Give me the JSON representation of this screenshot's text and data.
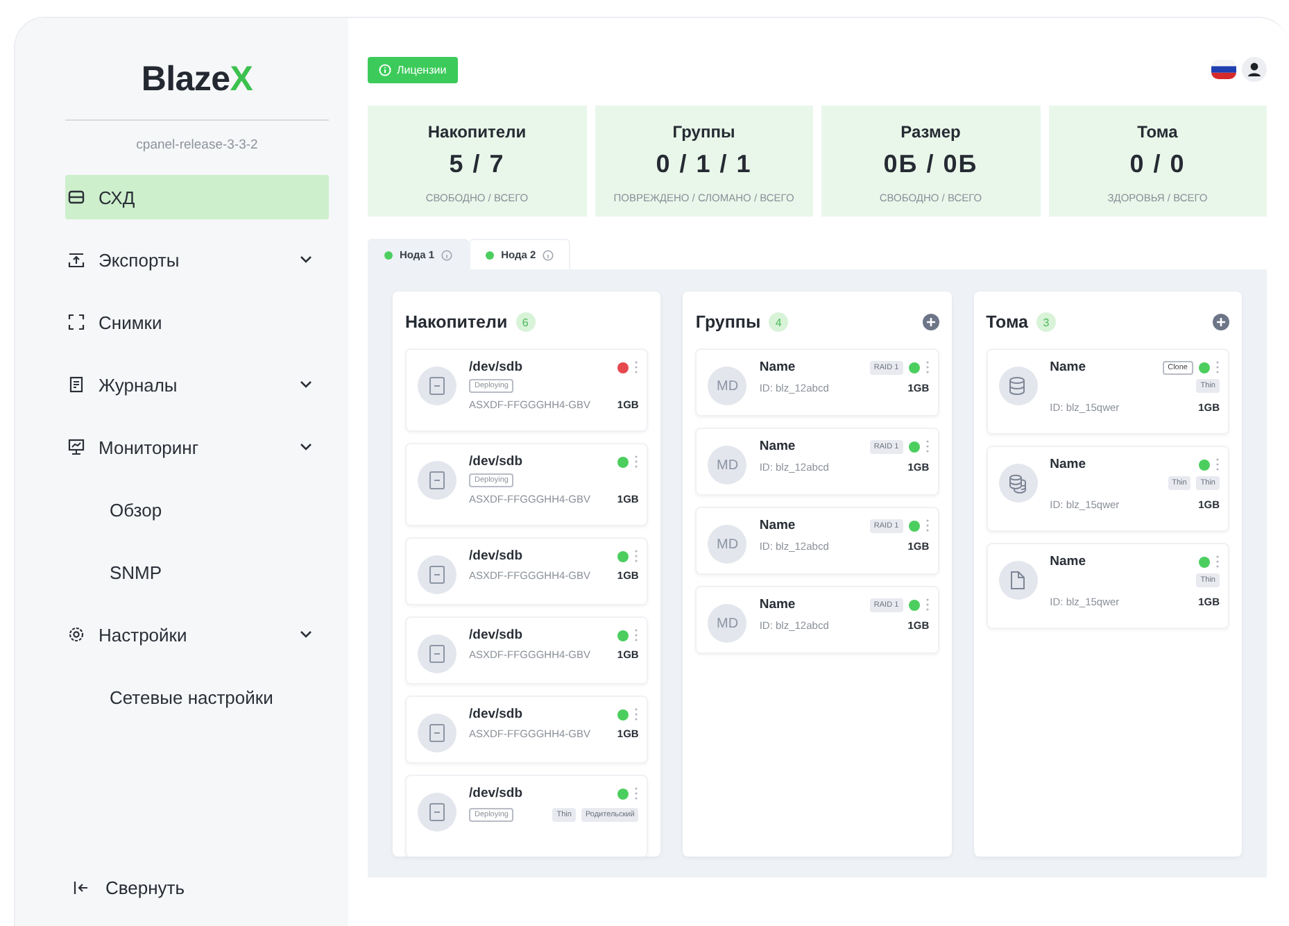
{
  "sidebar": {
    "logo": {
      "text": "Blaze",
      "accent": "X"
    },
    "version": "cpanel-release-3-3-2",
    "items": [
      {
        "label": "СХД",
        "selected": true,
        "expandable": false
      },
      {
        "label": "Экспорты",
        "selected": false,
        "expandable": true
      },
      {
        "label": "Снимки",
        "selected": false,
        "expandable": false
      },
      {
        "label": "Журналы",
        "selected": false,
        "expandable": true
      },
      {
        "label": "Мониторинг",
        "selected": false,
        "expandable": true,
        "children": [
          {
            "label": "Обзор",
            "selected": false
          },
          {
            "label": "SNMP",
            "selected": false
          }
        ]
      },
      {
        "label": "Настройки",
        "selected": false,
        "expandable": true,
        "children": [
          {
            "label": "Сетевые настройки",
            "selected": false
          }
        ]
      }
    ],
    "collapse": "Свернуть"
  },
  "header": {
    "license_button": "Лицензии"
  },
  "stats": [
    {
      "title": "Накопители",
      "value": "5 / 7",
      "caption": "СВОБОДНО / ВСЕГО"
    },
    {
      "title": "Группы",
      "value": "0 / 1 / 1",
      "caption": "ПОВРЕЖДЕНО / СЛОМАНО / ВСЕГО"
    },
    {
      "title": "Размер",
      "value": "0Б / 0Б",
      "caption": "СВОБОДНО / ВСЕГО"
    },
    {
      "title": "Тома",
      "value": "0 / 0",
      "caption": "ЗДОРОВЬЯ / ВСЕГО"
    }
  ],
  "tabs": [
    {
      "label": "Нода 1",
      "selected": true,
      "color": "#4cce5f"
    },
    {
      "label": "Нода 2",
      "selected": false,
      "color": "#4cce5f"
    }
  ],
  "columns": [
    {
      "kind": "drives",
      "title": "Накопители",
      "count": "6",
      "add_button": false,
      "items": [
        {
          "name": "/dev/sdb",
          "color": "#e5484d",
          "state": "Deploying",
          "serial": "ASXDF-FFGGGHH4-GBV",
          "size": "1GB"
        },
        {
          "name": "/dev/sdb",
          "color": "#4cce5f",
          "state": "Deploying",
          "serial": "ASXDF-FFGGGHH4-GBV",
          "size": "1GB"
        },
        {
          "name": "/dev/sdb",
          "color": "#4cce5f",
          "serial": "ASXDF-FFGGGHH4-GBV",
          "size": "1GB"
        },
        {
          "name": "/dev/sdb",
          "color": "#4cce5f",
          "serial": "ASXDF-FFGGGHH4-GBV",
          "size": "1GB"
        },
        {
          "name": "/dev/sdb",
          "color": "#4cce5f",
          "serial": "ASXDF-FFGGGHH4-GBV",
          "size": "1GB"
        },
        {
          "name": "/dev/sdb",
          "color": "#4cce5f",
          "state": "Deploying",
          "tags": [
            "Thin",
            "Родительский"
          ]
        }
      ]
    },
    {
      "kind": "groups",
      "title": "Группы",
      "count": "4",
      "add_button": true,
      "items": [
        {
          "avatar": "MD",
          "name": "Name",
          "raid": "RAID 1",
          "color": "#4cce5f",
          "id": "ID: blz_12abcd",
          "size": "1GB"
        },
        {
          "avatar": "MD",
          "name": "Name",
          "raid": "RAID 1",
          "color": "#4cce5f",
          "id": "ID: blz_12abcd",
          "size": "1GB"
        },
        {
          "avatar": "MD",
          "name": "Name",
          "raid": "RAID 1",
          "color": "#4cce5f",
          "id": "ID: blz_12abcd",
          "size": "1GB"
        },
        {
          "avatar": "MD",
          "name": "Name",
          "raid": "RAID 1",
          "color": "#4cce5f",
          "id": "ID: blz_12abcd",
          "size": "1GB"
        }
      ]
    },
    {
      "kind": "volumes",
      "title": "Тома",
      "count": "3",
      "add_button": true,
      "items": [
        {
          "kind": "database",
          "name": "Name",
          "clone": "Clone",
          "color": "#4cce5f",
          "tags": [
            "Thin"
          ],
          "id": "ID: blz_15qwer",
          "size": "1GB"
        },
        {
          "kind": "databases",
          "name": "Name",
          "color": "#4cce5f",
          "tags": [
            "Thin",
            "Thin"
          ],
          "id": "ID: blz_15qwer",
          "size": "1GB"
        },
        {
          "kind": "file",
          "name": "Name",
          "color": "#4cce5f",
          "tags": [
            "Thin"
          ],
          "id": "ID: blz_15qwer",
          "size": "1GB"
        }
      ]
    }
  ]
}
